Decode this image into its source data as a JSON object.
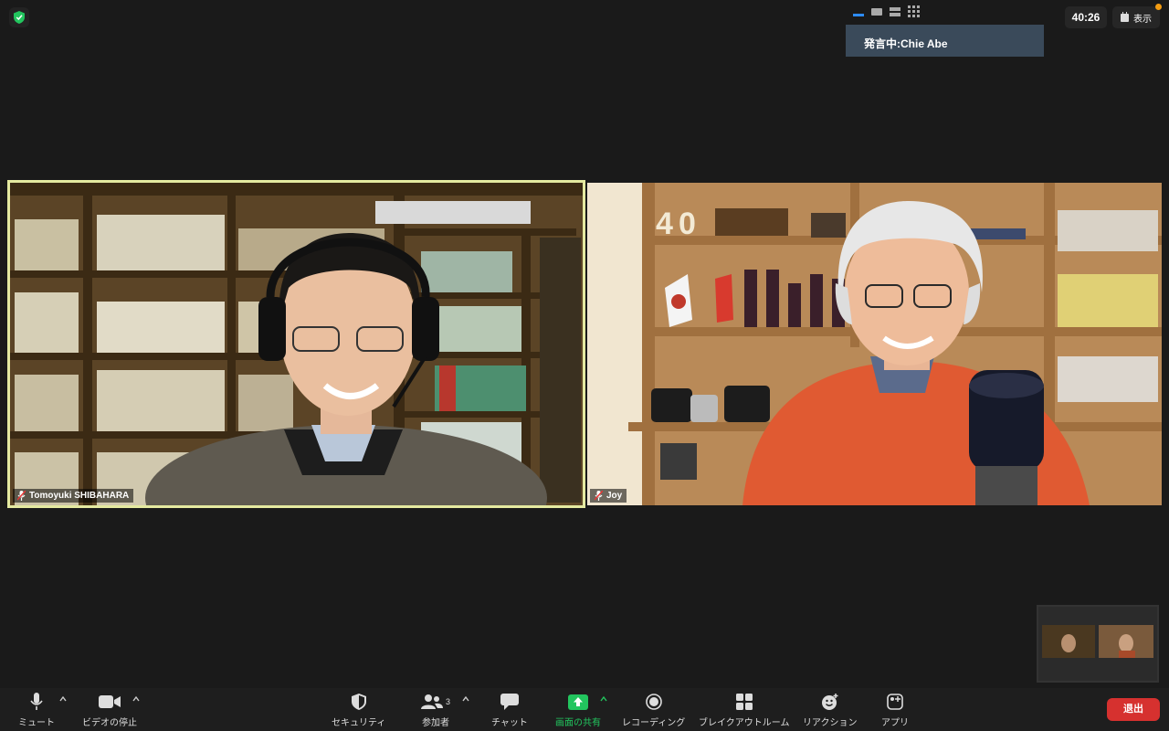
{
  "top": {
    "speaking_label": "発言中:Chie Abe",
    "timer": "40:26",
    "view_label": "表示"
  },
  "participants": [
    {
      "name": "Tomoyuki SHIBAHARA"
    },
    {
      "name": "Joy"
    }
  ],
  "toolbar": {
    "mute": "ミュート",
    "video": "ビデオの停止",
    "security": "セキュリティ",
    "participants": "参加者",
    "participants_count": "3",
    "chat": "チャット",
    "share": "画面の共有",
    "record": "レコーディング",
    "breakout": "ブレイクアウトルーム",
    "reactions": "リアクション",
    "apps": "アプリ",
    "leave": "退出"
  },
  "colors": {
    "share_green": "#22c55e",
    "leave_red": "#d6312f",
    "active_speaker_border": "#e4e9a0",
    "speaker_box": "#3a4a5a"
  }
}
